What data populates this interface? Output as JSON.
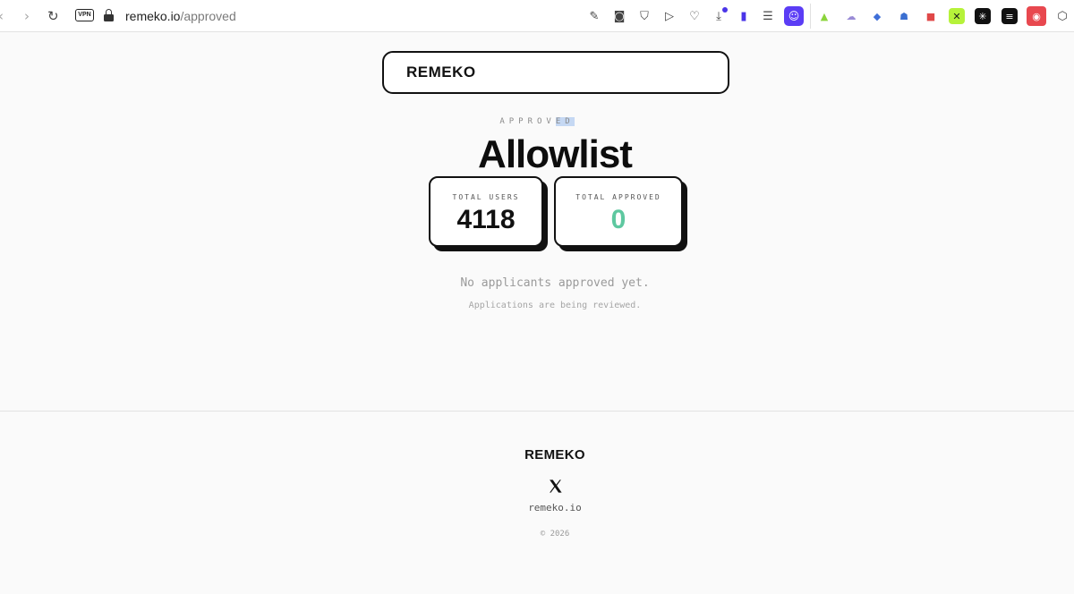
{
  "browser": {
    "url_host": "remeko.io",
    "url_path": "/approved",
    "vpn_label": "VPN",
    "nav": {
      "back_icon": "chevron-left-icon",
      "forward_icon": "chevron-right-icon",
      "reload_icon": "reload-icon"
    },
    "toolbar_icons": [
      "edit-icon",
      "camera-icon",
      "shield-icon",
      "play-icon",
      "heart-icon",
      "download-icon",
      "battery-icon",
      "menu-icon",
      "profile-icon"
    ],
    "extension_icons": [
      "chart-extension-icon",
      "cloud-extension-icon",
      "rabbit-extension-icon",
      "robot-extension-icon",
      "red-extension-icon",
      "green-extension-icon",
      "dark-extension-icon",
      "stack-extension-icon",
      "fox-extension-icon",
      "cube-extension-icon"
    ],
    "accent_color": "#5b3df5"
  },
  "header": {
    "brand": "REMEKO"
  },
  "main": {
    "eyebrow_plain": "APPROV",
    "eyebrow_highlight": "ED",
    "title": "Allowlist",
    "stats": [
      {
        "label": "TOTAL USERS",
        "value": "4118",
        "color": "#111111"
      },
      {
        "label": "TOTAL APPROVED",
        "value": "0",
        "color": "#5ec8a0"
      }
    ],
    "empty_message": "No applicants approved yet.",
    "empty_submessage": "Applications are being reviewed."
  },
  "footer": {
    "brand": "REMEKO",
    "social_icon": "x-icon",
    "link": "remeko.io",
    "copyright": "© 2026"
  }
}
